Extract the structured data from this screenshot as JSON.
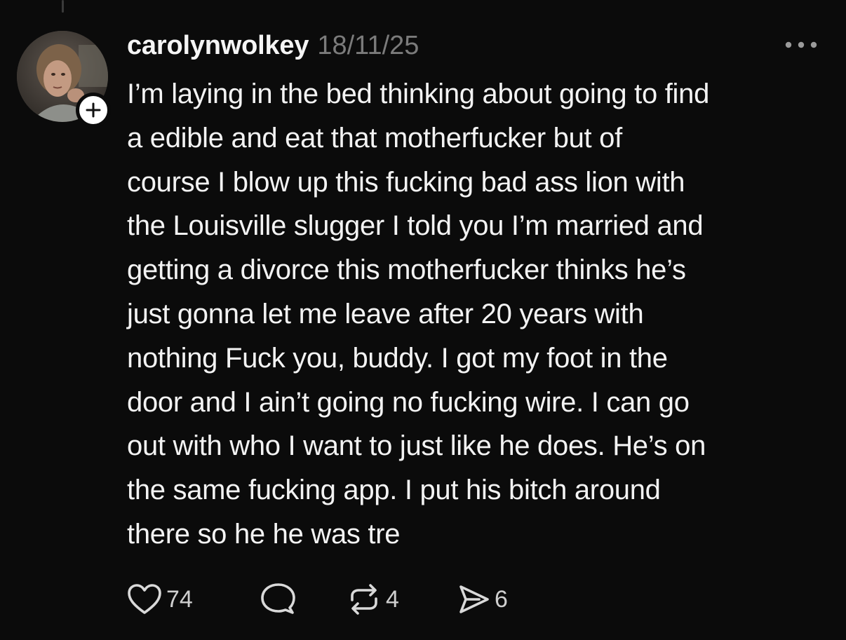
{
  "post": {
    "username": "carolynwolkey",
    "timestamp": "18/11/25",
    "body_lines": [
      "I’m laying in the bed thinking about going to find",
      "a edible and eat that motherfucker but of",
      "course I blow up this fucking bad ass lion with",
      "the Louisville slugger I told you I’m married and",
      "getting a divorce this motherfucker thinks he’s",
      "just gonna let me leave after 20 years with",
      "nothing Fuck you, buddy. I got my foot in the",
      "door and I ain’t going no fucking wire. I can go",
      "out with who I want to just like he does. He’s on",
      "the same fucking app. I put his bitch around",
      "there so he he was tre"
    ]
  },
  "actions": {
    "likes": "74",
    "reposts": "4",
    "shares": "6"
  },
  "icons": {
    "like": "heart-icon",
    "reply": "speech-bubble-icon",
    "repost": "repost-icon",
    "share": "send-icon",
    "more": "ellipsis-icon",
    "follow": "plus-icon"
  },
  "colors": {
    "background": "#0b0b0b",
    "text": "#f3f3f3",
    "muted": "#7b7b7b",
    "icon": "#d9d9d9"
  }
}
